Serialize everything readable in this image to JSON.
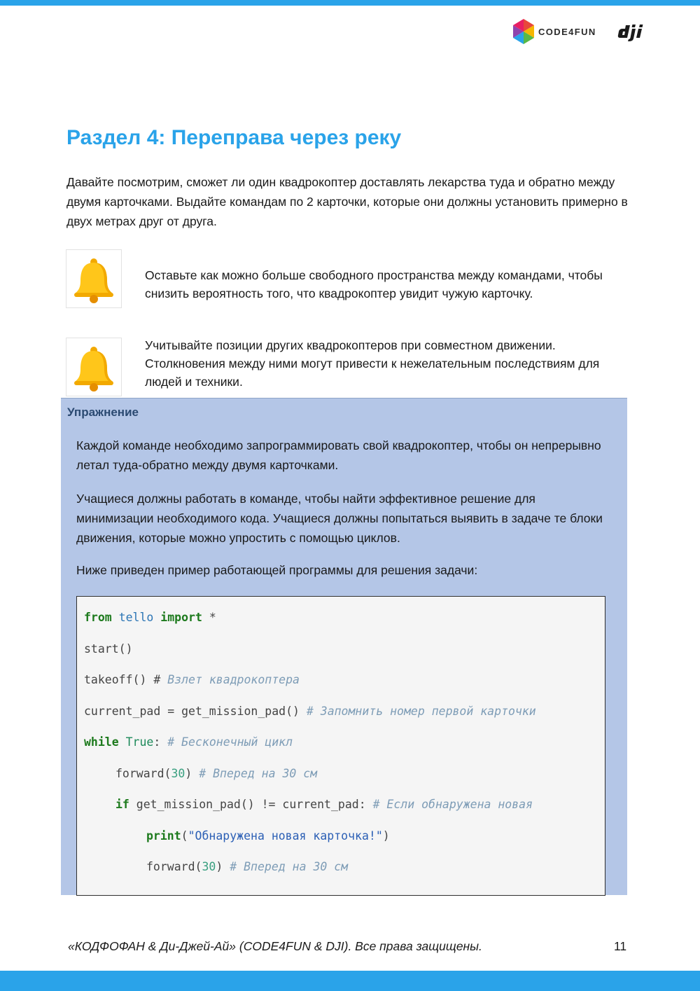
{
  "header": {
    "brand_logo": {
      "icon": "code4fun-hexagon-logo",
      "text": "CODE4FUN"
    },
    "partner_logo": {
      "icon": "dji-logo",
      "text": "dji"
    }
  },
  "section": {
    "title": "Раздел 4: Переправа через реку",
    "intro": "Давайте посмотрим, сможет ли один квадрокоптер доставлять лекарства туда и обратно между двумя карточками. Выдайте командам по 2 карточки, которые они должны установить примерно в двух метрах друг от друга."
  },
  "notes": [
    {
      "icon": "bell-icon",
      "text": "Оставьте как можно больше свободного пространства между командами, чтобы снизить вероятность того, что квадрокоптер увидит чужую карточку."
    },
    {
      "icon": "bell-icon",
      "text": "Учитывайте позиции других квадрокоптеров при совместном движении. Столкновения между ними могут привести к нежелательным последствиям для людей и техники."
    }
  ],
  "exercise": {
    "heading": "Упражнение",
    "paragraphs": [
      "Каждой команде необходимо запрограммировать свой квадрокоптер, чтобы он непрерывно летал туда-обратно между двумя карточками.",
      "Учащиеся должны работать в команде, чтобы найти эффективное решение для минимизации необходимого кода. Учащиеся должны попытаться выявить в задаче те блоки движения, которые можно упростить с помощью циклов.",
      "Ниже приведен пример работающей программы для решения задачи:"
    ],
    "code": {
      "l1": {
        "kw_from": "from",
        "module": "tello",
        "kw_import": "import",
        "rest": " *"
      },
      "l2": {
        "text": "start()"
      },
      "l3": {
        "code": "takeoff() # ",
        "comment": "Взлет квадрокоптера"
      },
      "l4": {
        "code": "current_pad = get_mission_pad() ",
        "comment": "# Запомнить номер первой карточки"
      },
      "l5": {
        "kw": "while",
        "value": "True",
        "colon": ":",
        "comment": "# Бесконечный цикл"
      },
      "l6": {
        "fn": "forward(",
        "num": "30",
        "close": ") ",
        "comment": "# Вперед на 30 см"
      },
      "l7": {
        "kw": "if",
        "code": " get_mission_pad() != current_pad: ",
        "comment": "# Если обнаружена новая"
      },
      "l8": {
        "fn": "print",
        "open": "(",
        "str": "\"Обнаружена новая карточка!\"",
        "close": ")"
      },
      "l9": {
        "fn": "forward(",
        "num": "30",
        "close": ") ",
        "comment": "# Вперед на 30 см"
      }
    }
  },
  "footer": {
    "copyright": "«КОДФОФАН & Ди-Джей-Ай» (CODE4FUN & DJI). Все права защищены.",
    "page_number": "11"
  },
  "colors": {
    "accent_blue": "#2aa3e9",
    "exercise_bg": "#b4c6e7",
    "exercise_heading": "#2b4a72",
    "code_bg": "#f5f5f5"
  }
}
